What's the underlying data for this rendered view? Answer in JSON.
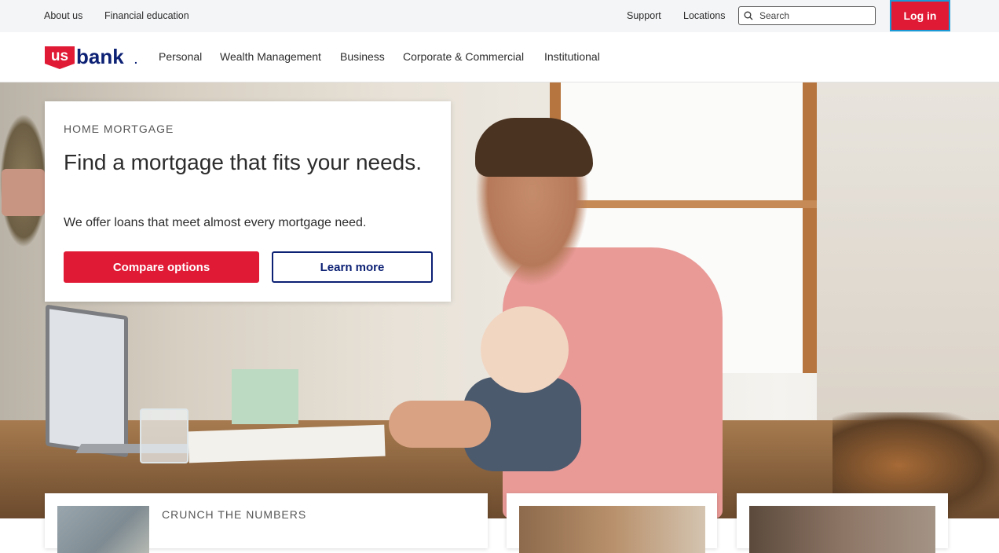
{
  "utility_bar": {
    "about_us": "About us",
    "financial_education": "Financial education",
    "support": "Support",
    "locations": "Locations",
    "search_placeholder": "Search",
    "login": "Log in"
  },
  "brand": {
    "logo_us": "us",
    "logo_bank": "bank",
    "logo_mark": ".",
    "primary_red": "#e01934",
    "navy": "#0c2074"
  },
  "nav": {
    "items": [
      "Personal",
      "Wealth Management",
      "Business",
      "Corporate & Commercial",
      "Institutional"
    ]
  },
  "hero": {
    "eyebrow": "HOME MORTGAGE",
    "headline": "Find a mortgage that fits your needs.",
    "subtext": "We offer loans that meet almost every mortgage need.",
    "primary_cta": "Compare options",
    "secondary_cta": "Learn more"
  },
  "promos": {
    "card1_eyebrow": "CRUNCH THE NUMBERS"
  }
}
